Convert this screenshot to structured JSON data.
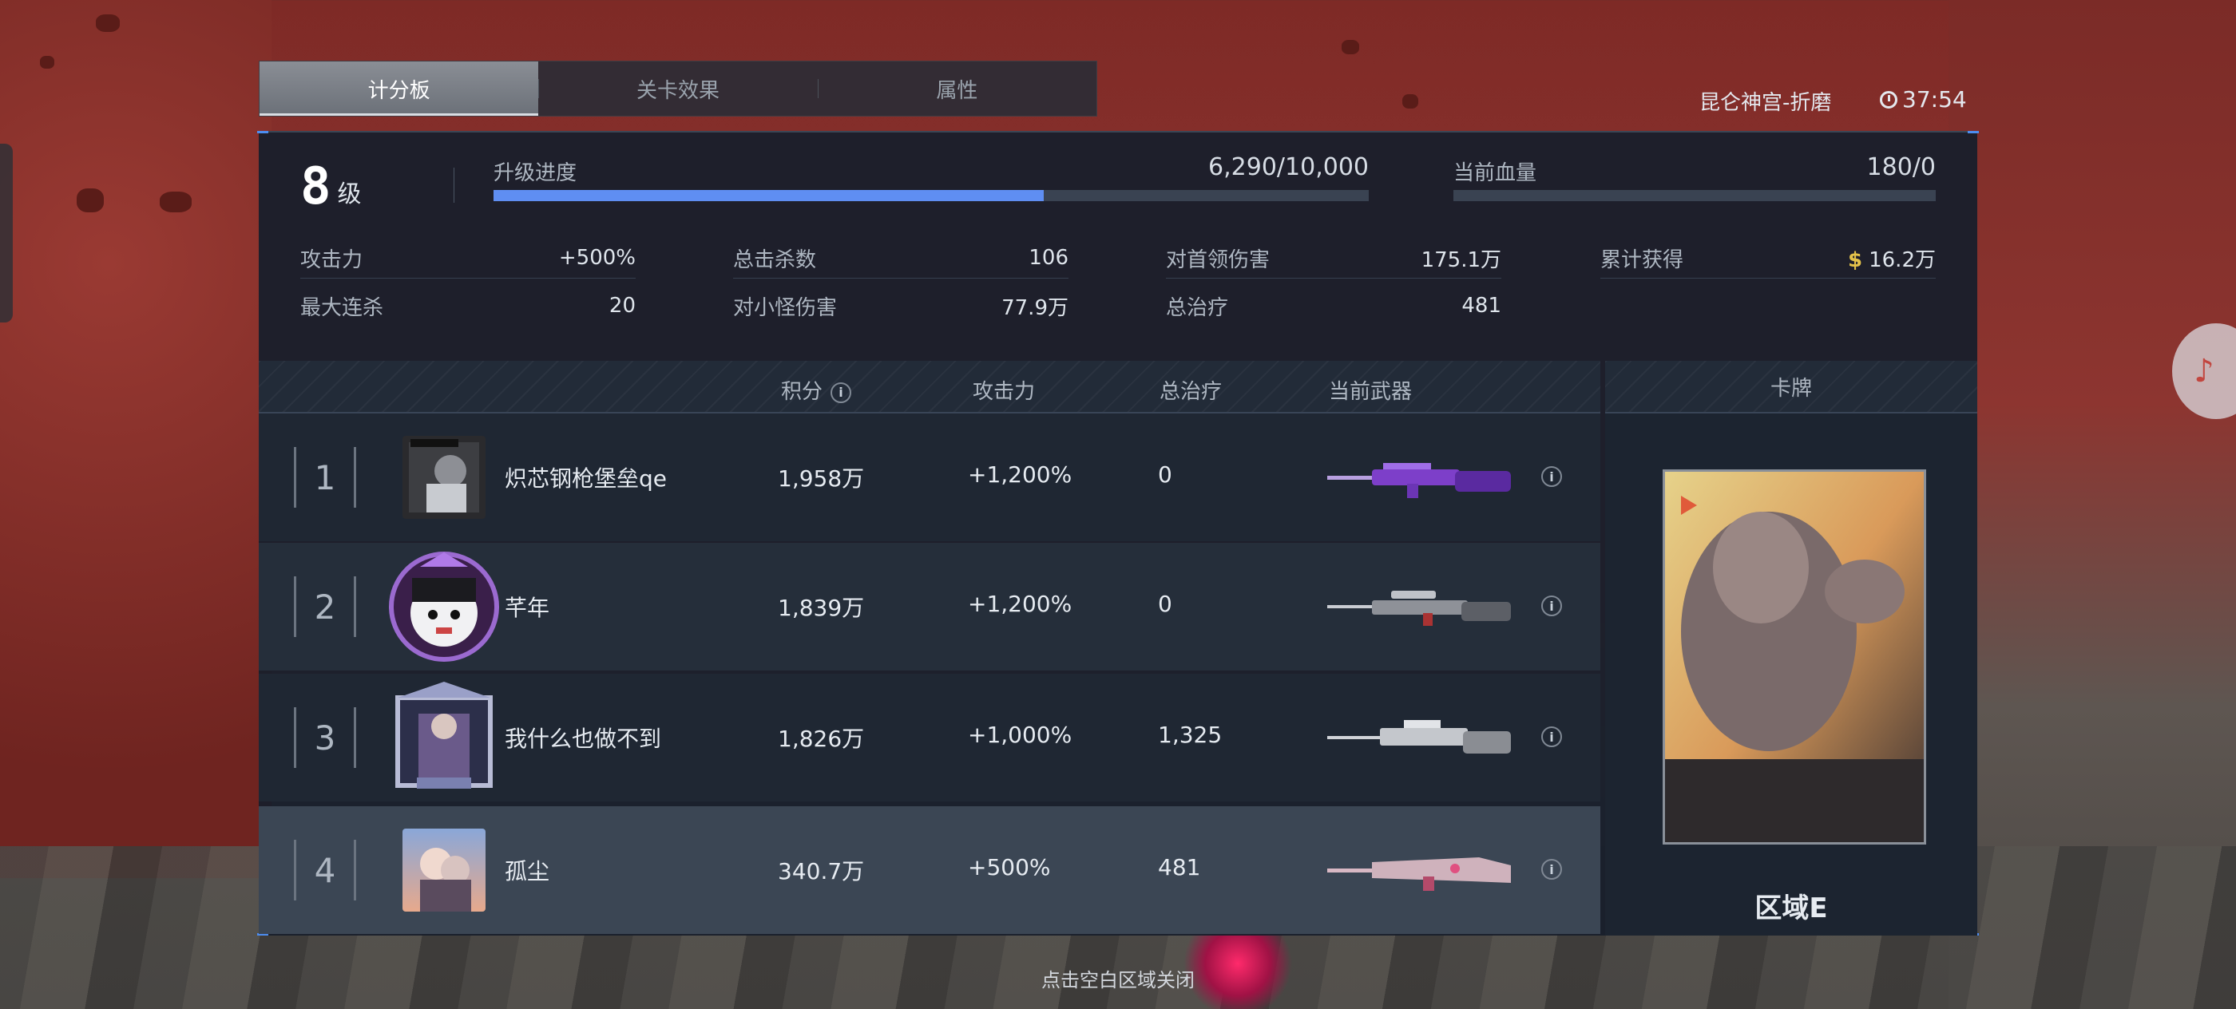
{
  "tabs": [
    {
      "label": "计分板",
      "active": true
    },
    {
      "label": "关卡效果",
      "active": false
    },
    {
      "label": "属性",
      "active": false
    }
  ],
  "header": {
    "location": "昆仑神宫-折磨",
    "timer": "37:54"
  },
  "summary": {
    "level_number": "8",
    "level_unit": "级",
    "progress_label": "升级进度",
    "progress_value": "6,290/10,000",
    "progress_fraction": 0.629,
    "hp_label": "当前血量",
    "hp_value": "180/0"
  },
  "stats": [
    {
      "label": "攻击力",
      "value": "+500%"
    },
    {
      "label": "最大连杀",
      "value": "20"
    },
    {
      "label": "总击杀数",
      "value": "106"
    },
    {
      "label": "对小怪伤害",
      "value": "77.9万"
    },
    {
      "label": "对首领伤害",
      "value": "175.1万"
    },
    {
      "label": "总治疗",
      "value": "481"
    },
    {
      "label": "累计获得",
      "value": "16.2万"
    }
  ],
  "table": {
    "headers": {
      "score": "积分",
      "attack": "攻击力",
      "heal": "总治疗",
      "weapon": "当前武器"
    },
    "rows": [
      {
        "rank": "1",
        "name": "炽芯钢枪堡垒qe",
        "score": "1,958万",
        "attack": "+1,200%",
        "heal": "0"
      },
      {
        "rank": "2",
        "name": "芊年",
        "score": "1,839万",
        "attack": "+1,200%",
        "heal": "0"
      },
      {
        "rank": "3",
        "name": "我什么也做不到",
        "score": "1,826万",
        "attack": "+1,000%",
        "heal": "1,325"
      },
      {
        "rank": "4",
        "name": "孤尘",
        "score": "340.7万",
        "attack": "+500%",
        "heal": "481"
      }
    ]
  },
  "card": {
    "header": "卡牌",
    "zone": "区域E"
  },
  "footer": {
    "close_hint": "点击空白区域关闭"
  },
  "colors": {
    "accent": "#5f8ef2",
    "panel": "#18202b",
    "highlight_row": "#3b4654",
    "coin": "#e4c24a"
  }
}
